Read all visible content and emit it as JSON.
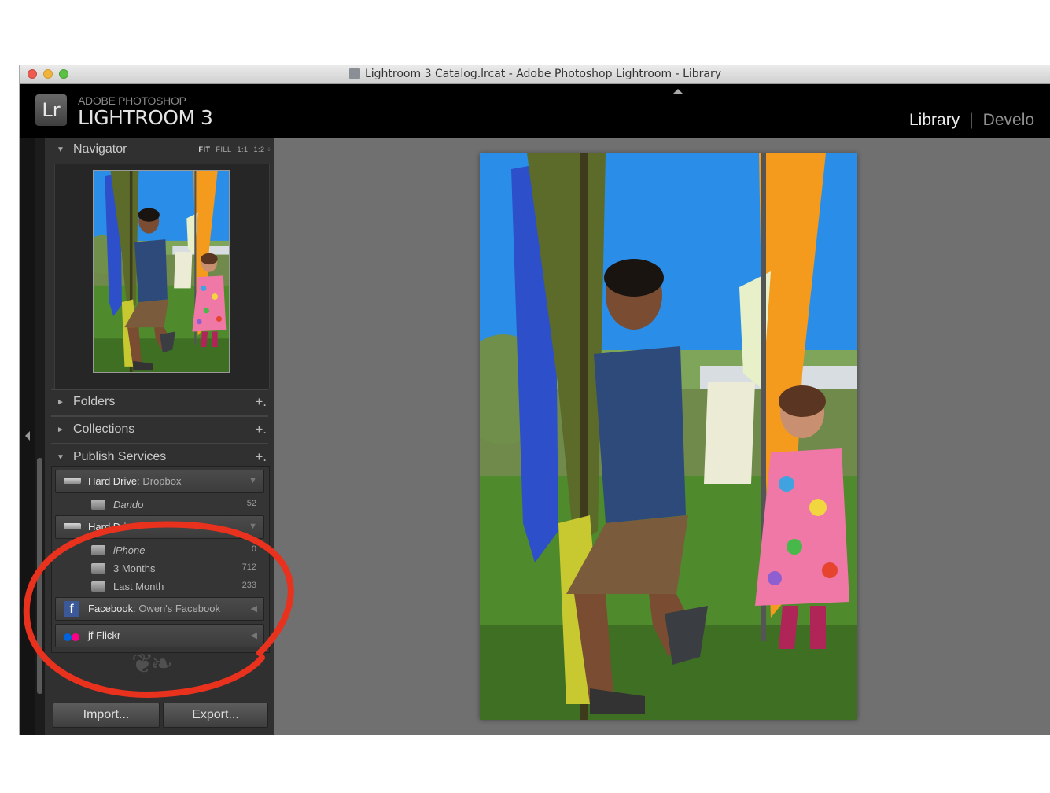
{
  "window": {
    "title": "Lightroom 3 Catalog.lrcat - Adobe Photoshop Lightroom - Library"
  },
  "identity": {
    "badge": "Lr",
    "vendor": "ADOBE PHOTOSHOP",
    "product": "LIGHTROOM 3",
    "modules": [
      "Library",
      "Develo"
    ],
    "module_separator": "|"
  },
  "navigator": {
    "label": "Navigator",
    "zoom": [
      "FIT",
      "FILL",
      "1:1",
      "1:2 ÷"
    ]
  },
  "panels": {
    "folders": "Folders",
    "collections": "Collections",
    "publish": "Publish Services",
    "plus": "+."
  },
  "publish_services": {
    "dropbox": {
      "name": "Hard Drive",
      "sub": ": Dropbox"
    },
    "dando": {
      "label": "Dando",
      "count": "52"
    },
    "hard2": {
      "name": "Hard Dri"
    },
    "iphone": {
      "label": "iPhone",
      "count": "0"
    },
    "three_months": {
      "label": "3 Months",
      "count": "712"
    },
    "last_month": {
      "label": "Last Month",
      "count": "233"
    },
    "facebook": {
      "name": "Facebook",
      "sub": ": Owen's Facebook"
    },
    "flickr": {
      "name": "jf Flickr"
    }
  },
  "icons": {
    "facebook_glyph": "f"
  },
  "buttons": {
    "import": "Import...",
    "export": "Export..."
  },
  "colors": {
    "annotation": "#e8321e",
    "facebook": "#3b5998",
    "flickr_blue": "#0063dc",
    "flickr_pink": "#ff0084"
  }
}
